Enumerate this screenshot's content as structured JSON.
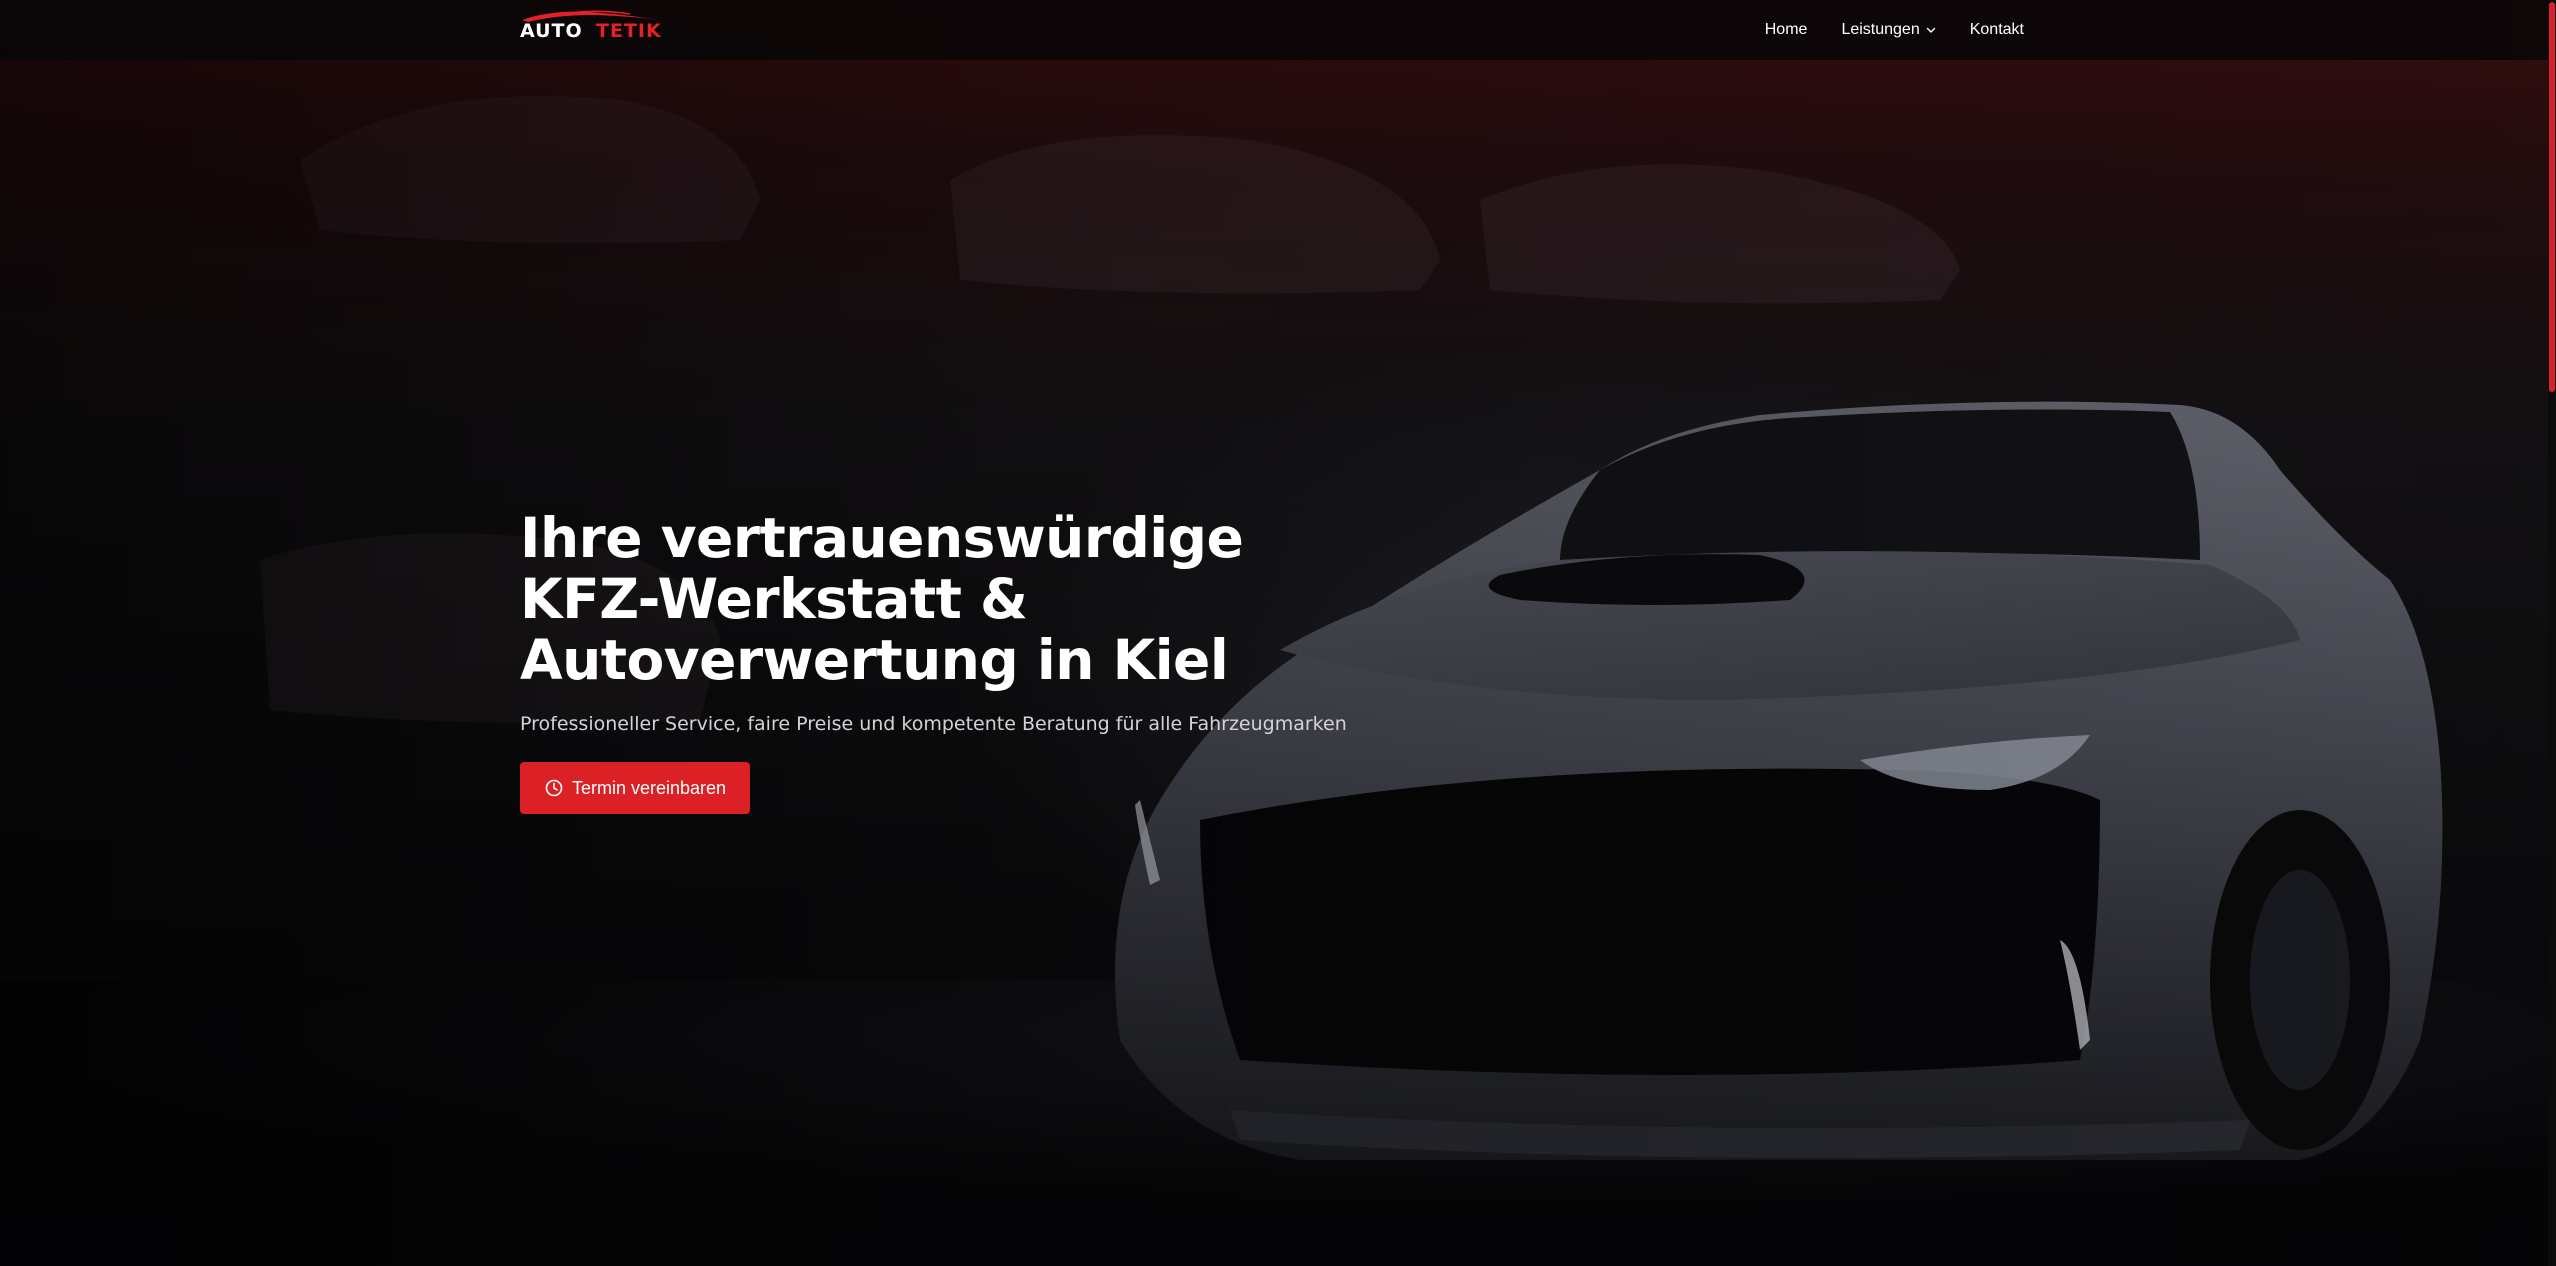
{
  "brand": {
    "logo_part1": "AUTO",
    "logo_part2": "TETIK",
    "accent_color": "#dc2126"
  },
  "nav": {
    "items": [
      {
        "label": "Home"
      },
      {
        "label": "Leistungen",
        "icon": "chevron-down-icon"
      },
      {
        "label": "Kontakt"
      }
    ]
  },
  "hero": {
    "title_lines": [
      "Ihre vertrauenswürdige",
      "KFZ-Werkstatt &",
      "Autoverwertung in Kiel"
    ],
    "subtitle": "Professioneller Service, faire Preise und kompetente Beratung für alle Fahrzeugmarken",
    "cta_label": "Termin vereinbaren",
    "cta_icon": "clock-icon"
  },
  "scrollbar": {
    "thumb_color": "#d8222b"
  }
}
